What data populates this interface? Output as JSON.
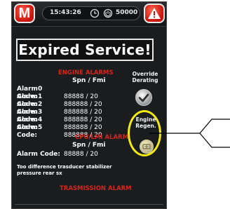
{
  "topbar": {
    "logo_letter": "M",
    "time": "15:43:26",
    "hour_counter": "50000",
    "clock_icon": "clock-icon",
    "power_icon": "power-icon",
    "warning_icon": "warning-triangle-icon"
  },
  "banner": "Expired Service!",
  "engine_alarms": {
    "title": "ENGINE ALARMS",
    "header": "Spn  /  Fmi",
    "rows": [
      {
        "label": "Alarm0 Code:",
        "value": "88888 / 20"
      },
      {
        "label": "Alarm1 Code:",
        "value": "888888 / 20"
      },
      {
        "label": "Alarm2 Code:",
        "value": "888888 / 20"
      },
      {
        "label": "Alarm3 Code:",
        "value": "888888 / 20"
      },
      {
        "label": "Alarm4 Code:",
        "value": "888888 / 20"
      },
      {
        "label": "Alarm5 Code:",
        "value": "888888 / 20"
      }
    ]
  },
  "side_controls": {
    "override_label_1": "Override",
    "override_label_2": "Derating",
    "regen_label_1": "Engine",
    "regen_label_2": "Regen."
  },
  "cpu_lmi_alarm": {
    "title": "CPU/LMI ALARM",
    "header": "Spn  /  Fmi",
    "row": {
      "label": "Alarm Code:",
      "value": "88888 / 20"
    },
    "description": "Too difference trasducer stabilizer pressure rear sx"
  },
  "transmission_alarm": {
    "title": "TRASMISSION ALARM"
  },
  "colors": {
    "alarm_title": "#d6261c",
    "highlight": "#f2ea15",
    "brand_red": "#c8140c"
  }
}
